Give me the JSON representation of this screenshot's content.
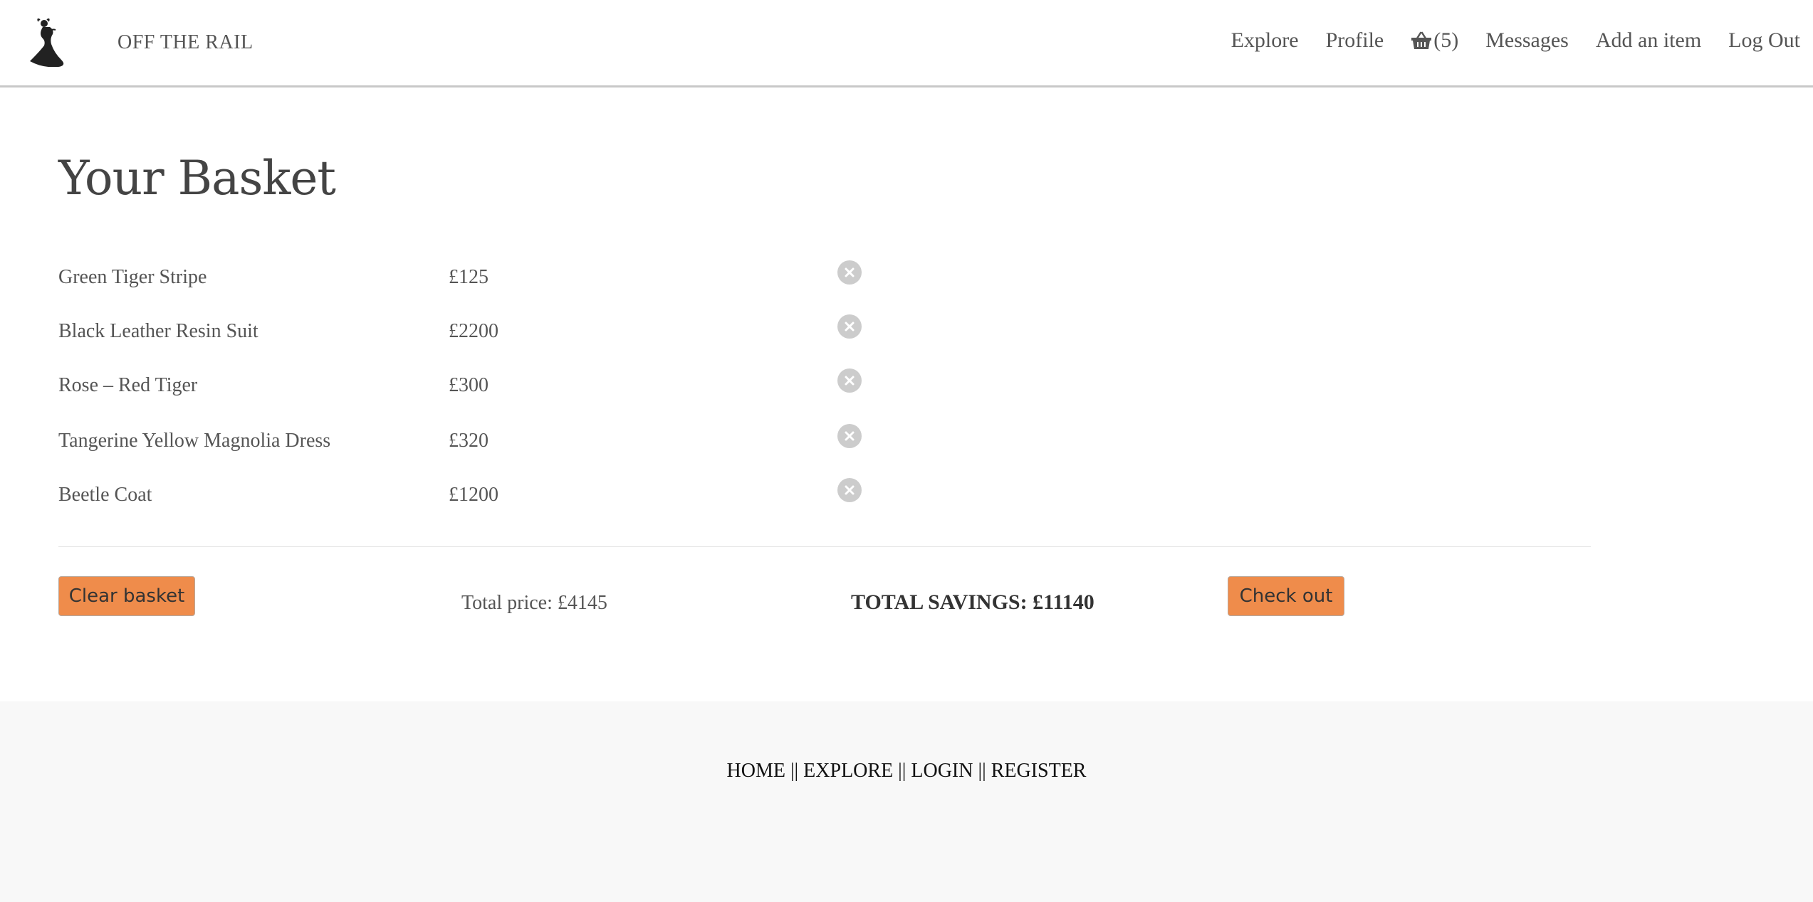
{
  "brand": {
    "name": "OFF THE RAIL",
    "logo_icon": "woman-silhouette-icon"
  },
  "nav": {
    "explore": "Explore",
    "profile": "Profile",
    "basket_count": "(5)",
    "basket_icon": "basket-icon",
    "messages": "Messages",
    "add_item": "Add an item",
    "logout": "Log Out"
  },
  "page": {
    "title": "Your Basket"
  },
  "basket": {
    "items": [
      {
        "name": "Green Tiger Stripe",
        "price": "£125"
      },
      {
        "name": "Black Leather Resin Suit",
        "price": "£2200"
      },
      {
        "name": "Rose – Red Tiger",
        "price": "£300"
      },
      {
        "name": "Tangerine Yellow Magnolia Dress",
        "price": "£320"
      },
      {
        "name": "Beetle Coat",
        "price": "£1200"
      }
    ],
    "remove_icon": "remove-circle-icon",
    "clear_label": "Clear basket",
    "total_price": "Total price: £4145",
    "total_savings": "TOTAL SAVINGS: £11140",
    "checkout_label": "Check out"
  },
  "footer": {
    "home": "HOME",
    "explore": "EXPLORE",
    "login": "LOGIN",
    "register": "REGISTER",
    "separator": "||"
  },
  "colors": {
    "accent": "#ef8c4b",
    "footer_bg": "#f8f8f8",
    "remove_icon": "#cccccc"
  }
}
